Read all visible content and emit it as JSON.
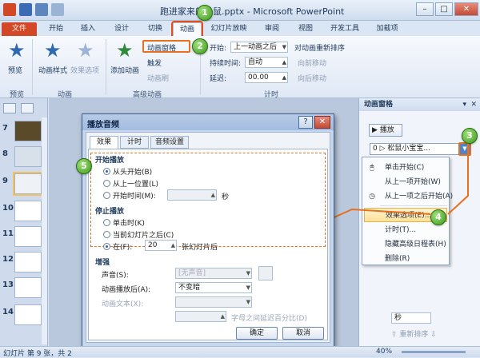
{
  "window": {
    "title": "跑进家来的松鼠.pptx - Microsoft PowerPoint"
  },
  "tabs": [
    "文件",
    "开始",
    "插入",
    "设计",
    "切换",
    "动画",
    "幻灯片放映",
    "审阅",
    "视图",
    "开发工具",
    "加载项"
  ],
  "ribbon": {
    "preview_label": "预览",
    "anim_style_label": "动画样式",
    "effect_options_label": "效果选项",
    "add_anim_label": "添加动画",
    "anim_pane_btn": "动画窗格",
    "trigger_label": "触发",
    "anim_painter_label": "动画刷",
    "start_label": "开始:",
    "start_value": "上一动画之后",
    "duration_label": "持续时间:",
    "duration_value": "自动",
    "delay_label": "延迟:",
    "delay_value": "00.00",
    "reorder_label": "对动画重新排序",
    "move_earlier": "向前移动",
    "move_later": "向后移动",
    "groups": {
      "preview": "预览",
      "animation": "动画",
      "advanced": "高级动画",
      "timing": "计时"
    }
  },
  "thumbnails": [
    {
      "num": "7"
    },
    {
      "num": "8"
    },
    {
      "num": "9"
    },
    {
      "num": "10"
    },
    {
      "num": "11"
    },
    {
      "num": "12"
    },
    {
      "num": "13"
    },
    {
      "num": "14"
    }
  ],
  "anim_pane": {
    "title": "动画窗格",
    "play_label": "播放",
    "item_label": "0 ▷ 松鼠小宝宝...",
    "sec_label": "秒",
    "reorder_label": "重新排序",
    "menu": [
      "单击开始(C)",
      "从上一项开始(W)",
      "从上一项之后开始(A)",
      "效果选项(E)...",
      "计时(T)...",
      "隐藏高级日程表(H)",
      "删除(R)"
    ]
  },
  "dialog": {
    "title": "播放音频",
    "tabs": [
      "效果",
      "计时",
      "音频设置"
    ],
    "start_section": "开始播放",
    "start_options": [
      "从头开始(B)",
      "从上一位置(L)",
      "开始时间(M):"
    ],
    "start_time_unit": "秒",
    "stop_section": "停止播放",
    "stop_options": [
      "单击时(K)",
      "当前幻灯片之后(C)",
      "在(F):"
    ],
    "stop_after_value": "20",
    "stop_after_unit": "张幻灯片后",
    "enhance_section": "增强",
    "sound_label": "声音(S):",
    "sound_value": "[无声音]",
    "after_anim_label": "动画播放后(A):",
    "after_anim_value": "不变暗",
    "anim_text_label": "动画文本(X):",
    "text_delay_label": "字母之间延迟百分比(D)",
    "ok_label": "确定",
    "cancel_label": "取消"
  },
  "callouts": [
    "1",
    "2",
    "3",
    "4",
    "5"
  ],
  "status": {
    "slide_info": "幻灯片 第 9 张，共 2",
    "zoom": "40%"
  },
  "colors": {
    "accent": "#e8701e",
    "file_tab": "#d24726",
    "callout_green": "#3c9a1c"
  }
}
